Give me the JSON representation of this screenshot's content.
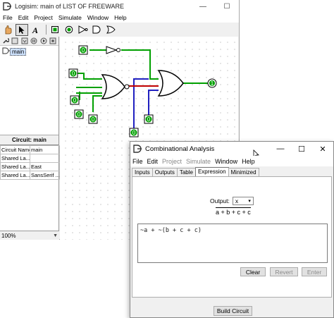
{
  "main_window": {
    "title": "Logisim: main of LIST OF FREEWARE",
    "controls": {
      "minimize": "—",
      "maximize": "☐"
    },
    "menu": [
      "File",
      "Edit",
      "Project",
      "Simulate",
      "Window",
      "Help"
    ],
    "tree": {
      "item": "main"
    },
    "attributes": {
      "header": "Circuit: main",
      "rows": [
        {
          "key": "Circuit Name",
          "value": "main"
        },
        {
          "key": "Shared La...",
          "value": ""
        },
        {
          "key": "Shared La...",
          "value": "East"
        },
        {
          "key": "Shared La...",
          "value": "SansSerif ..."
        }
      ]
    },
    "zoom": "100%",
    "circuit": {
      "inputs": [
        "0",
        "0",
        "0",
        "0",
        "0",
        "0",
        "0"
      ],
      "output": "1",
      "colors": {
        "wire_high": "#00a000",
        "wire_low": "#2020c0",
        "wire_error": "#c00000"
      }
    }
  },
  "ca_window": {
    "title": "Combinational Analysis",
    "controls": {
      "minimize": "—",
      "maximize": "☐",
      "close": "✕"
    },
    "menu": [
      "File",
      "Edit",
      "Project",
      "Simulate",
      "Window",
      "Help"
    ],
    "tabs": [
      "Inputs",
      "Outputs",
      "Table",
      "Expression",
      "Minimized"
    ],
    "active_tab": "Expression",
    "output_label": "Output:",
    "output_value": "x",
    "expression_display": "a + b + c + c",
    "expression_text": "~a + ~(b + c + c)",
    "buttons": {
      "clear": "Clear",
      "revert": "Revert",
      "enter": "Enter",
      "build": "Build Circuit"
    }
  }
}
